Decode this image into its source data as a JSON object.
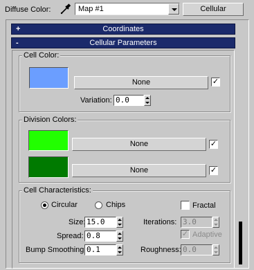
{
  "header": {
    "diffuse_label": "Diffuse Color:",
    "map_value": "Map #1",
    "type_button": "Cellular"
  },
  "rollouts": {
    "coordinates": {
      "sign": "+",
      "title": "Coordinates"
    },
    "cellular": {
      "sign": "-",
      "title": "Cellular Parameters"
    }
  },
  "cell_color": {
    "title": "Cell Color:",
    "swatch_color": "#6b9eff",
    "map_button": "None",
    "map_enabled": "✓",
    "variation_label": "Variation:",
    "variation_value": "0.0"
  },
  "division_colors": {
    "title": "Division Colors:",
    "swatch1_color": "#22ff00",
    "swatch2_color": "#007a00",
    "map1_button": "None",
    "map1_enabled": "✓",
    "map2_button": "None",
    "map2_enabled": "✓"
  },
  "cell_characteristics": {
    "title": "Cell Characteristics:",
    "circular_label": "Circular",
    "chips_label": "Chips",
    "fractal_label": "Fractal",
    "size_label": "Size:",
    "size_value": "15.0",
    "spread_label": "Spread:",
    "spread_value": "0.8",
    "bump_label": "Bump Smoothing:",
    "bump_value": "0.1",
    "iterations_label": "Iterations:",
    "iterations_value": "3.0",
    "adaptive_label": "Adaptive",
    "adaptive_check": "✓",
    "roughness_label": "Roughness:",
    "roughness_value": "0.0"
  }
}
